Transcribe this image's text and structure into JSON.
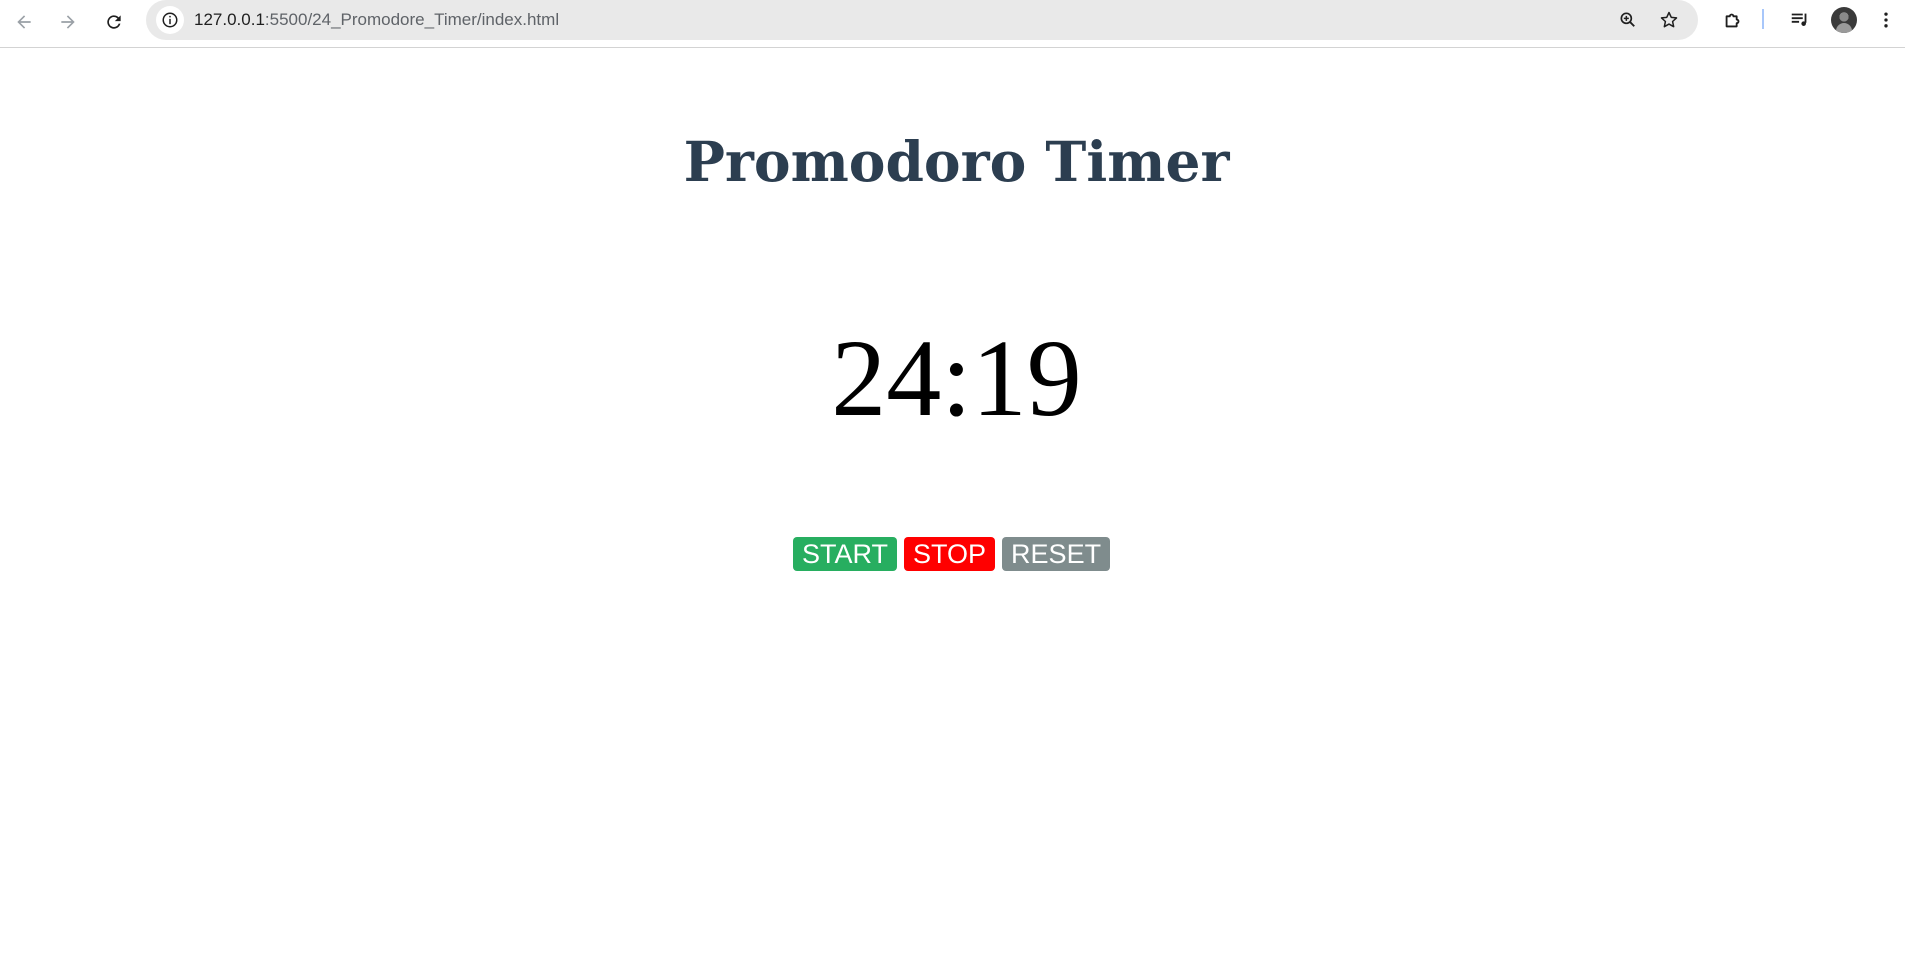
{
  "browser": {
    "url_host": "127.0.0.1",
    "url_rest": ":5500/24_Promodore_Timer/index.html"
  },
  "icons": {
    "back": "arrow-left-icon",
    "forward": "arrow-right-icon",
    "reload": "reload-icon",
    "site_info": "info-icon",
    "zoom": "zoom-icon",
    "bookmark": "star-icon",
    "extensions": "puzzle-icon",
    "media": "media-queue-icon",
    "profile": "avatar"
  },
  "app": {
    "title": "Promodoro Timer",
    "time": "24:19"
  },
  "controls": {
    "start_label": "START",
    "stop_label": "STOP",
    "reset_label": "RESET"
  },
  "colors": {
    "title": "#2c3e50",
    "start": "#27ae60",
    "stop": "#ff0000",
    "reset": "#7f8c8d"
  }
}
